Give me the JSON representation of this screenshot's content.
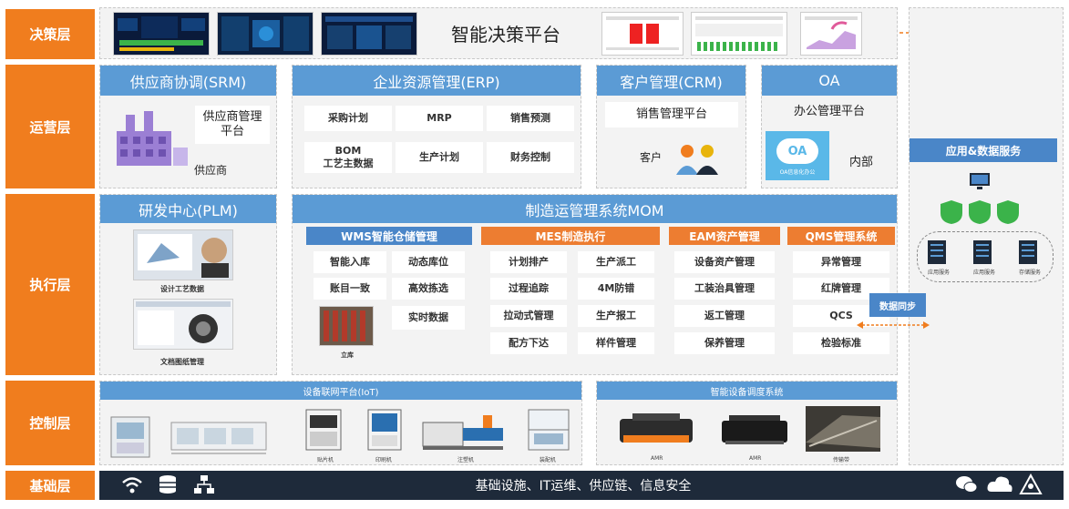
{
  "layers": [
    "决策层",
    "运营层",
    "执行层",
    "控制层",
    "基础层"
  ],
  "decision": {
    "title": "智能决策平台"
  },
  "srm": {
    "title": "供应商协调(SRM)",
    "platform": "供应商管理平台",
    "supplier": "供应商"
  },
  "erp": {
    "title": "企业资源管理(ERP)",
    "items": [
      "采购计划",
      "MRP",
      "销售预测",
      "BOM\n工艺主数据",
      "生产计划",
      "财务控制"
    ]
  },
  "crm": {
    "title": "客户管理(CRM)",
    "platform": "销售管理平台",
    "customer": "客户"
  },
  "oa": {
    "title": "OA",
    "platform": "办公管理平台",
    "logo": "OA",
    "logo_caption": "OA信息化办公",
    "internal": "内部"
  },
  "plm": {
    "title": "研发中心(PLM)",
    "caption1": "设计工艺数据",
    "caption2": "文档图纸管理"
  },
  "mom": {
    "title": "制造运管理系统MOM",
    "wms": {
      "title": "WMS智能仓储管理",
      "items": [
        "智能入库",
        "动态库位",
        "账目一致",
        "高效拣选",
        "实时数据"
      ],
      "img_caption": "立库"
    },
    "mes": {
      "title": "MES制造执行",
      "items": [
        "计划排产",
        "生产派工",
        "过程追踪",
        "4M防错",
        "拉动式管理",
        "生产报工",
        "配方下达",
        "样件管理"
      ]
    },
    "eam": {
      "title": "EAM资产管理",
      "items": [
        "设备资产管理",
        "工装治具管理",
        "返工管理",
        "保养管理"
      ]
    },
    "qms": {
      "title": "QMS管理系统",
      "items": [
        "异常管理",
        "红牌管理",
        "QCS",
        "检验标准"
      ]
    }
  },
  "sync": {
    "label": "数据同步"
  },
  "app": {
    "title": "应用&数据服务",
    "server_labels": [
      "应用服务",
      "应用服务",
      "存储服务"
    ]
  },
  "iot": {
    "title": "设备联网平台(IoT)",
    "labels": [
      "贴片机",
      "印刷机",
      "注塑机",
      "装配机"
    ]
  },
  "dispatch": {
    "title": "智能设备调度系统",
    "labels": [
      "AMR",
      "AMR",
      "传输带"
    ]
  },
  "base": {
    "text": "基础设施、IT运维、供应链、信息安全"
  },
  "colors": {
    "orange": "#f07d1e",
    "blue_header": "#5b9bd5",
    "dark_bar": "#1e2a3a",
    "green": "#3bb34a"
  },
  "icons": [
    "wifi-icon",
    "database-icon",
    "network-icon",
    "wechat-icon",
    "cloud-icon",
    "signal-icon"
  ]
}
